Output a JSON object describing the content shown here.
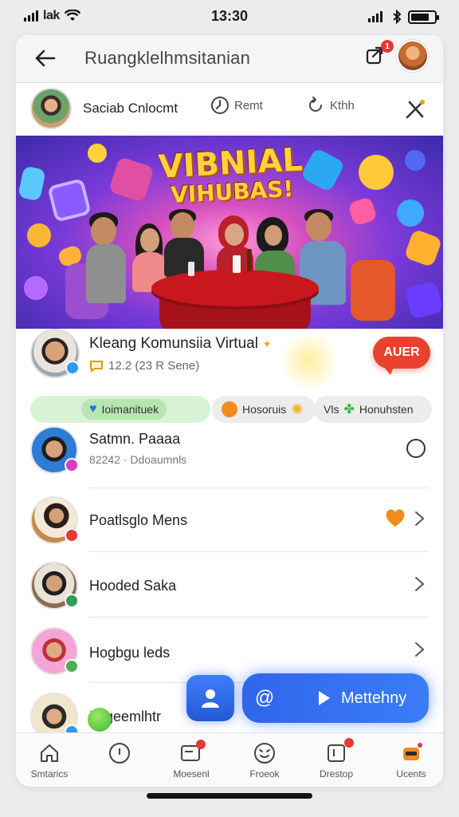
{
  "status_bar": {
    "carrier": "lak",
    "time": "13:30"
  },
  "header": {
    "title": "Ruangklelhmsitanian",
    "notification_count": "1"
  },
  "profile": {
    "name": "Saciab Cnlocmt",
    "actions": [
      {
        "label": "Remt",
        "icon": "clock-icon"
      },
      {
        "label": "Kthh",
        "icon": "refresh-icon"
      }
    ]
  },
  "banner": {
    "title_line1": "VIBNIAL",
    "title_line2": "VIHUBAS!"
  },
  "group": {
    "title": "Kleang Komunsiia Virtual",
    "subtitle": "12.2 (23 R Sene)",
    "join_label": "AUER",
    "accent_color": "#e8422c"
  },
  "chips": [
    {
      "label": "Ioimanituek",
      "color": "#d8f2d6"
    },
    {
      "label": "Hosoruis",
      "color": "#ececec"
    },
    {
      "label": "Vls",
      "color": "#ececec"
    },
    {
      "label": "Honuhsten",
      "color": "#ececec"
    }
  ],
  "members": [
    {
      "name": "Satmn. Paaaa",
      "sub": "82242 · Ddoaumnls",
      "status_color": "#d63cc8"
    },
    {
      "name": "Poatlsglo Mens",
      "sub": "",
      "status_color": "#e53935"
    },
    {
      "name": "Hooded Saka",
      "sub": "",
      "status_color": "#2e9d5a"
    },
    {
      "name": "Hogbgu leds",
      "sub": "",
      "status_color": "#4caf50"
    },
    {
      "name": "Logeemlhtr",
      "sub": "",
      "status_color": "#2b9bf4"
    }
  ],
  "cta": {
    "label": "Mettehny",
    "at_symbol": "@"
  },
  "tabs": [
    {
      "label": "Smtarics",
      "icon": "home-icon"
    },
    {
      "label": "",
      "icon": "chat-icon"
    },
    {
      "label": "Moesenl",
      "icon": "inbox-icon",
      "badge": ""
    },
    {
      "label": "Froeok",
      "icon": "smile-icon"
    },
    {
      "label": "Drestop",
      "icon": "compose-icon",
      "badge": ""
    },
    {
      "label": "Ucents",
      "icon": "profile-icon"
    }
  ]
}
